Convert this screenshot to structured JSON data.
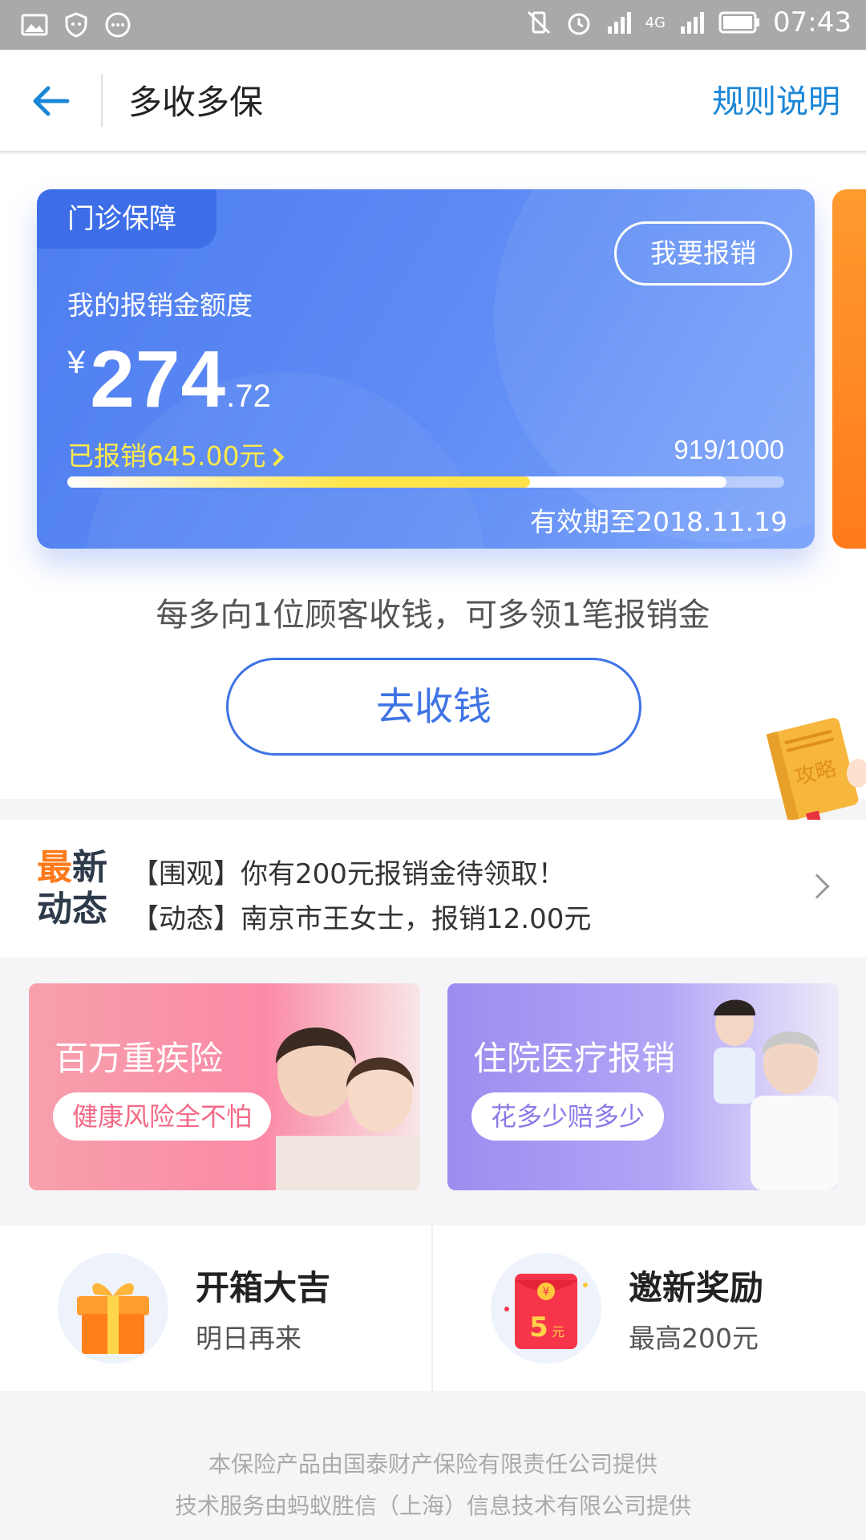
{
  "status_bar": {
    "time": "07:43",
    "network": "4G"
  },
  "nav": {
    "title": "多收多保",
    "rules_link": "规则说明"
  },
  "card": {
    "tag": "门诊保障",
    "claim_button": "我要报销",
    "quota_label": "我的报销金额度",
    "currency": "¥",
    "amount_int": "274",
    "amount_dec": ".72",
    "used_text": "已报销645.00元",
    "progress_text": "919/1000",
    "progress_value": 0.919,
    "used_fraction": 0.645,
    "validity": "有效期至2018.11.19"
  },
  "promo_text": "每多向1位顾客收钱，可多领1笔报销金",
  "collect_button": "去收钱",
  "guide_label": "攻略",
  "news": {
    "badge_line1_a": "最",
    "badge_line1_b": "新",
    "badge_line2": "动态",
    "items": [
      "【围观】你有200元报销金待领取！",
      "【动态】南京市王女士，报销12.00元"
    ]
  },
  "banners": [
    {
      "title": "百万重疾险",
      "pill": "健康风险全不怕"
    },
    {
      "title": "住院医疗报销",
      "pill": "花多少赔多少"
    }
  ],
  "features": [
    {
      "title": "开箱大吉",
      "subtitle": "明日再来",
      "icon": "gift-box-icon"
    },
    {
      "title": "邀新奖励",
      "subtitle": "最高200元",
      "icon": "red-envelope-icon",
      "icon_text": "5",
      "icon_unit": "元",
      "icon_currency": "¥"
    }
  ],
  "footer": {
    "line1": "本保险产品由国泰财产保险有限责任公司提供",
    "line2": "技术服务由蚂蚁胜信（上海）信息技术有限公司提供"
  }
}
